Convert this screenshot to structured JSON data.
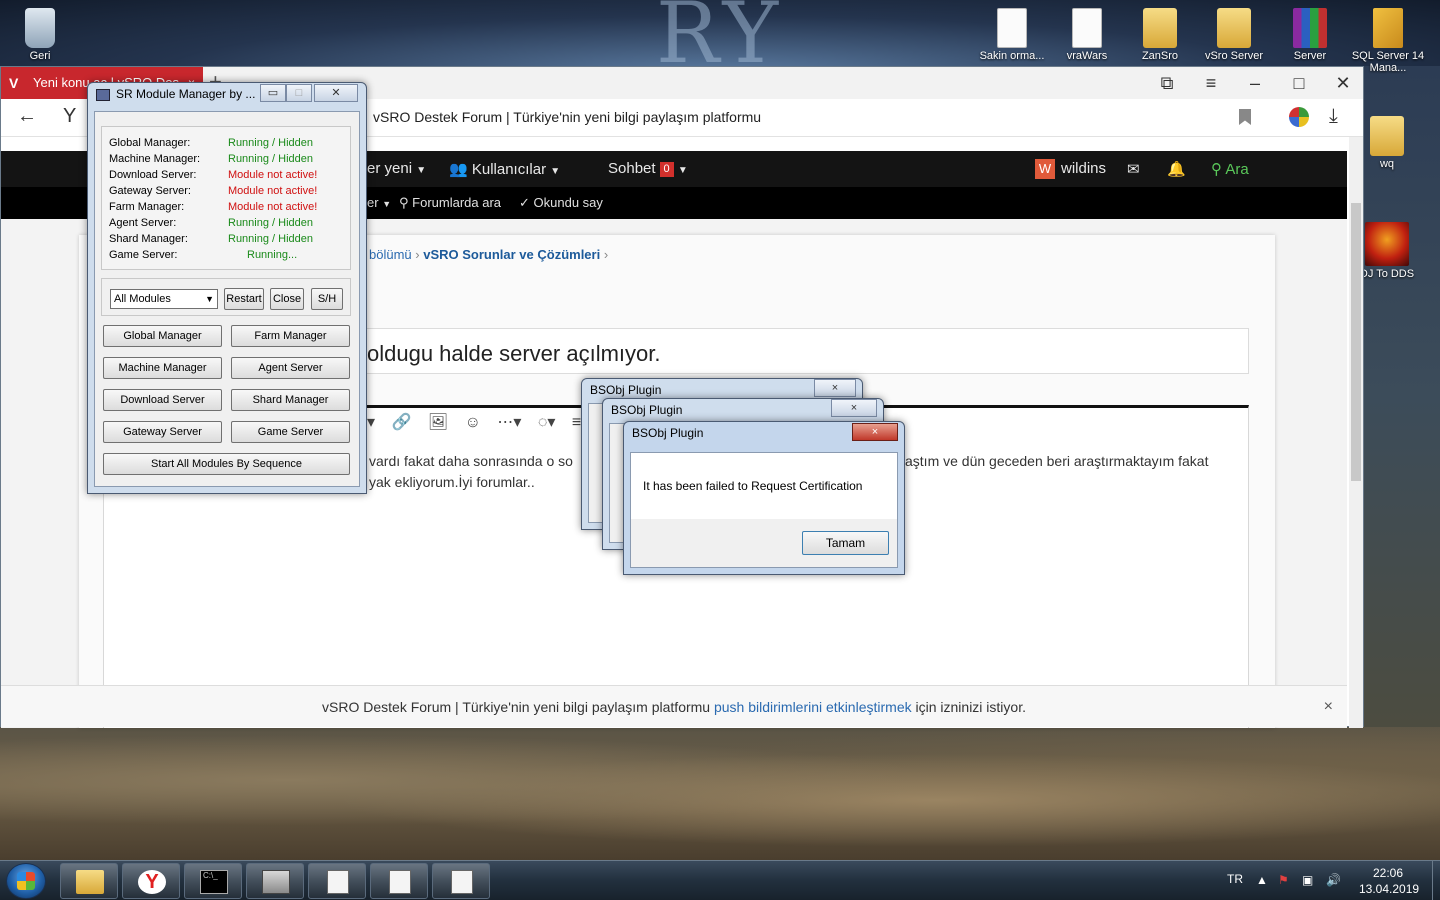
{
  "desktop": {
    "icons": [
      {
        "label": "Geri",
        "glyph": "recycle-bin"
      },
      {
        "label": "Sakin orma...",
        "glyph": "document"
      },
      {
        "label": "vraWars",
        "glyph": "document"
      },
      {
        "label": "ZanSro",
        "glyph": "folder"
      },
      {
        "label": "vSro Server",
        "glyph": "folder"
      },
      {
        "label": "Server",
        "glyph": "winrar-archive"
      },
      {
        "label": "SQL Server 14 Mana...",
        "glyph": "sql-management-studio"
      },
      {
        "label": "wq",
        "glyph": "folder"
      },
      {
        "label": "DJ To DDS",
        "glyph": "dds-converter"
      }
    ]
  },
  "browser": {
    "tab_title": "Yeni konu aç | vSRO Des",
    "tab_close": "×",
    "new_tab": "+",
    "address_title": "vSRO Destek Forum | Türkiye'nin yeni bilgi paylaşım platformu",
    "site": {
      "nav": {
        "whats_new": "er yeni",
        "members": "Kullanıcılar",
        "chat": "Sohbet",
        "chat_badge": "0",
        "user_initial": "W",
        "username": "wildins",
        "search": "Ara"
      },
      "subnav": {
        "partial": "er",
        "search_forums": "Forumlarda ara",
        "mark_read": "Okundu say"
      },
      "breadcrumb": {
        "section": "bölümü",
        "forum": "vSRO Sorunlar ve Çözümleri"
      },
      "thread_title": "oldugu halde server açılmıyor.",
      "editor_line_1_left": "vardı fakat daha sonrasında o so",
      "editor_line_1_right": "aştım ve dün geceden beri araştırmaktayım fakat",
      "editor_line_2": "yak ekliyorum.İyi forumlar.."
    },
    "notification": {
      "text_before": "vSRO Destek Forum | Türkiye'nin yeni bilgi paylaşım platformu",
      "link": "push bildirimlerini etkinleştirmek",
      "text_after": "için izninizi istiyor.",
      "close": "×"
    }
  },
  "module_manager": {
    "title": "SR Module Manager by ...",
    "statuses": [
      {
        "name": "Global Manager:",
        "value": "Running / Hidden",
        "state": "ok"
      },
      {
        "name": "Machine Manager:",
        "value": "Running / Hidden",
        "state": "ok"
      },
      {
        "name": "Download Server:",
        "value": "Module not active!",
        "state": "bad"
      },
      {
        "name": "Gateway Server:",
        "value": "Module not active!",
        "state": "bad"
      },
      {
        "name": "Farm Manager:",
        "value": "Module not active!",
        "state": "bad"
      },
      {
        "name": "Agent Server:",
        "value": "Running / Hidden",
        "state": "ok"
      },
      {
        "name": "Shard Manager:",
        "value": "Running / Hidden",
        "state": "ok"
      },
      {
        "name": "Game Server:",
        "value": "Running...",
        "state": "ok"
      }
    ],
    "module_select": "All Modules",
    "restart": "Restart",
    "close": "Close",
    "show_hide": "S/H",
    "buttons": {
      "global_manager": "Global Manager",
      "farm_manager": "Farm Manager",
      "machine_manager": "Machine Manager",
      "agent_server": "Agent Server",
      "download_server": "Download Server",
      "shard_manager": "Shard Manager",
      "gateway_server": "Gateway Server",
      "game_server": "Game Server",
      "start_all": "Start All Modules By Sequence"
    }
  },
  "dialogs": {
    "back_title_1": "BSObj Plugin",
    "back_title_2": "BSObj Plugin",
    "front_title": "BSObj Plugin",
    "message": "It has been failed to Request Certification",
    "ok_button": "Tamam",
    "close": "×"
  },
  "taskbar": {
    "language": "TR",
    "time": "22:06",
    "date": "13.04.2019"
  }
}
